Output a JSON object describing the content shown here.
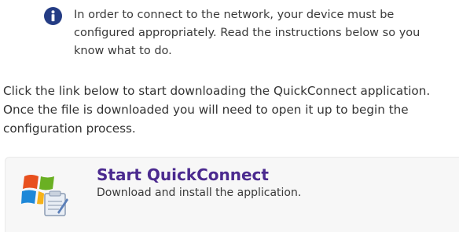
{
  "notice": {
    "icon": "info-icon",
    "text": "In order to connect to the network, your device must be configured appropriately. Read the instructions below so you know what to do."
  },
  "instructions": {
    "text": "Click the link below to start downloading the QuickConnect application. Once the file is downloaded you will need to open it up to begin the configuration process."
  },
  "action": {
    "icon": "windows-installer-icon",
    "title": "Start QuickConnect",
    "subtitle": "Download and install the application."
  },
  "colors": {
    "info_icon_bg": "#243c84",
    "title_color": "#4b2a8f",
    "box_bg": "#f7f7f7"
  }
}
